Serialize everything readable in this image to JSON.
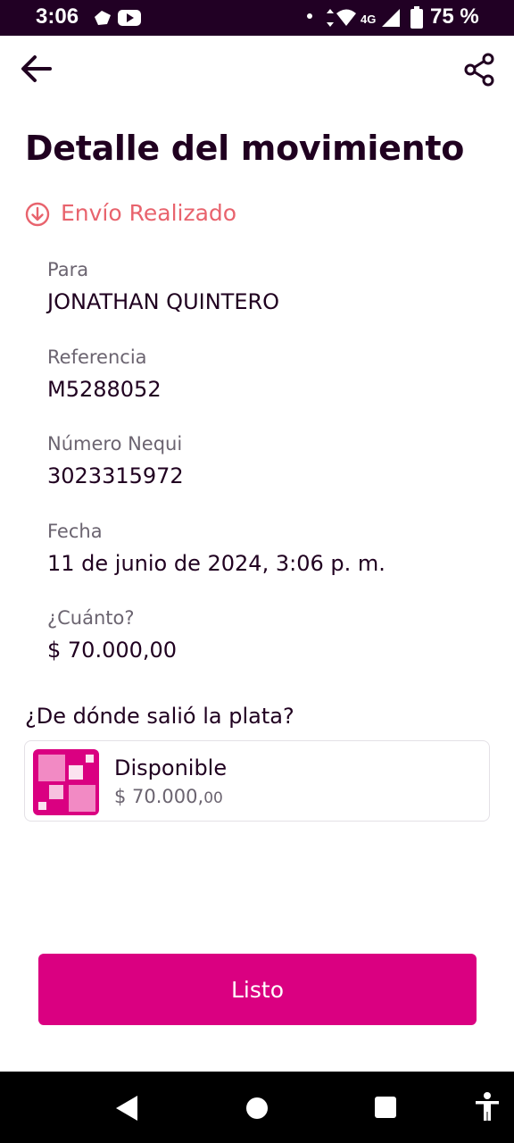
{
  "status_bar": {
    "time": "3:06",
    "battery": "75 %",
    "network": "4G",
    "icons": [
      "notification-app-icon",
      "youtube-icon",
      "dot-icon",
      "data-arrows-icon",
      "wifi-icon",
      "signal-icon",
      "battery-icon"
    ]
  },
  "app_bar": {
    "back_icon": "arrow-left-icon",
    "share_icon": "share-icon"
  },
  "page": {
    "title": "Detalle del movimiento",
    "status_label": "Envío Realizado",
    "status_color": "#e8636d"
  },
  "details": [
    {
      "label": "Para",
      "value": "JONATHAN QUINTERO"
    },
    {
      "label": "Referencia",
      "value": "M5288052"
    },
    {
      "label": "Número Nequi",
      "value": "3023315972"
    },
    {
      "label": "Fecha",
      "value": "11 de junio de 2024, 3:06 p. m."
    },
    {
      "label": "¿Cuánto?",
      "value": "$ 70.000,00"
    }
  ],
  "source": {
    "question": "¿De dónde salió la plata?",
    "name": "Disponible",
    "amount_main": "$ 70.000,",
    "amount_cents": "00"
  },
  "actions": {
    "done_label": "Listo"
  },
  "colors": {
    "accent": "#da0081",
    "text": "#200020",
    "muted": "#6b6470",
    "status_bar": "#210024"
  }
}
